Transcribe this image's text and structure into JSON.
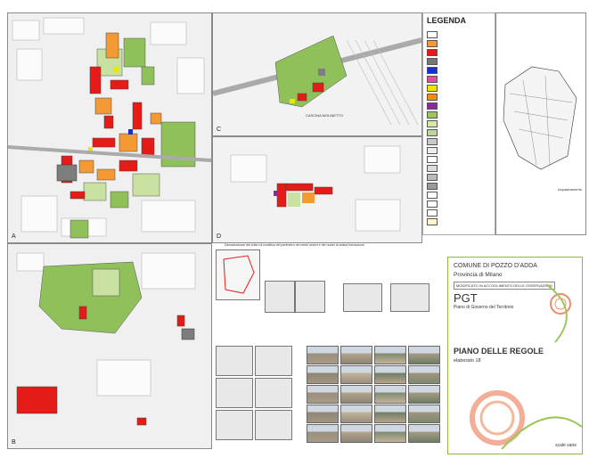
{
  "legend": {
    "title": "LEGENDA",
    "swatches": [
      "#ffffff",
      "#f39a34",
      "#e41b17",
      "#777777",
      "#1a2dd1",
      "#e94aa0",
      "#f0e400",
      "#ff8c00",
      "#8a2aa0",
      "#9ec65a",
      "#d7e8a2",
      "#b9d79a",
      "#c8c8c8",
      "#ececec",
      "#ffffff",
      "#dddddd",
      "#bbbbbb",
      "#999999",
      "#ffffff",
      "#ffffff",
      "#ffffff",
      "#fff6cc"
    ]
  },
  "panels": {
    "a": "A",
    "b": "B",
    "c": "C",
    "d": "D"
  },
  "labels": {
    "cascina": "CASCINA MOLINETTO",
    "quadro": "Inquadramento"
  },
  "section_title": "Dimostrazione dei criteri di modifica del perimetro dei centri storici e dei nuclei di antica formazione",
  "title_block": {
    "comune": "COMUNE DI POZZO D'ADDA",
    "provincia": "Provincia di Milano",
    "subtitle": "MODIFICATO IN ACCOGLIMENTO DELLE OSSERVAZIONI",
    "pgt": "PGT",
    "pgt_full": "Piano di Governo del Territorio",
    "piano": "PIANO DELLE REGOLE",
    "elaborato": "elaborato 18",
    "scale": "scale varie"
  },
  "colors": {
    "red": "#e41b17",
    "orange": "#f39a34",
    "green": "#8fc05a",
    "lightgreen": "#c8e0a0",
    "grey": "#7d7d7d",
    "yellow": "#f0e400",
    "blue": "#1a2dd1"
  }
}
